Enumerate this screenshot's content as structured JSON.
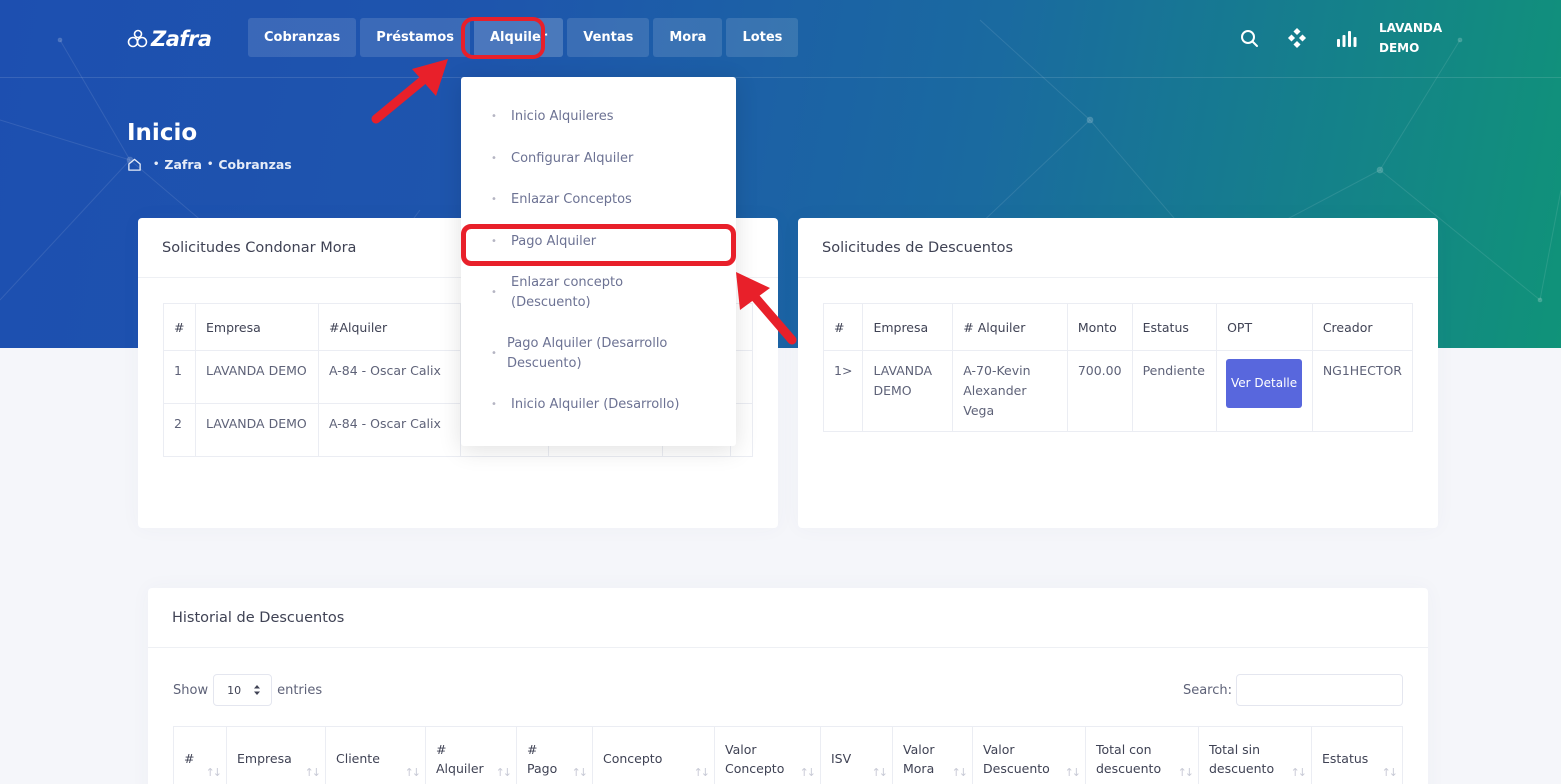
{
  "brand": {
    "name": "Zafra"
  },
  "nav": {
    "items": [
      "Cobranzas",
      "Préstamos",
      "Alquiler",
      "Ventas",
      "Mora",
      "Lotes"
    ],
    "active": "Alquiler"
  },
  "user": {
    "line1": "LAVANDA",
    "line2": "DEMO"
  },
  "page": {
    "title": "Inicio",
    "breadcrumb": [
      "Zafra",
      "Cobranzas"
    ]
  },
  "dropdown": {
    "items": [
      "Inicio Alquileres",
      "Configurar Alquiler",
      "Enlazar Conceptos",
      "Pago Alquiler",
      "Enlazar concepto (Descuento)",
      "Pago Alquiler (Desarrollo Descuento)",
      "Inicio Alquiler (Desarrollo)"
    ],
    "highlighted": "Pago Alquiler"
  },
  "condonar": {
    "title": "Solicitudes Condonar Mora",
    "headers": [
      "#",
      "Empresa",
      "#Alquiler"
    ],
    "rows": [
      [
        "1",
        "LAVANDA DEMO",
        "A-84 - Oscar Calix"
      ],
      [
        "2",
        "LAVANDA DEMO",
        "A-84 - Oscar Calix"
      ]
    ]
  },
  "descuentos": {
    "title": "Solicitudes de Descuentos",
    "headers": [
      "#",
      "Empresa",
      "# Alquiler",
      "Monto",
      "Estatus",
      "OPT",
      "Creador"
    ],
    "rows": [
      {
        "num": "1>",
        "empresa": "LAVANDA DEMO",
        "alquiler": "A-70-Kevin Alexander Vega",
        "monto": "700.00",
        "estatus": "Pendiente",
        "button": "Ver Detalle",
        "creador": "NG1HECTOR"
      }
    ]
  },
  "historial": {
    "title": "Historial de Descuentos",
    "show_label": "Show",
    "entries_value": "10",
    "entries_label": "entries",
    "search_label": "Search:",
    "headers": [
      "#",
      "Empresa",
      "Cliente",
      "# Alquiler",
      "# Pago",
      "Concepto",
      "Valor Concepto",
      "ISV",
      "Valor Mora",
      "Valor Descuento",
      "Total con descuento",
      "Total sin descuento",
      "Estatus"
    ]
  },
  "colors": {
    "accent_red": "#e8202a",
    "primary_button": "#5867dd",
    "hero_start": "#1d4fb0",
    "hero_end": "#109379"
  }
}
